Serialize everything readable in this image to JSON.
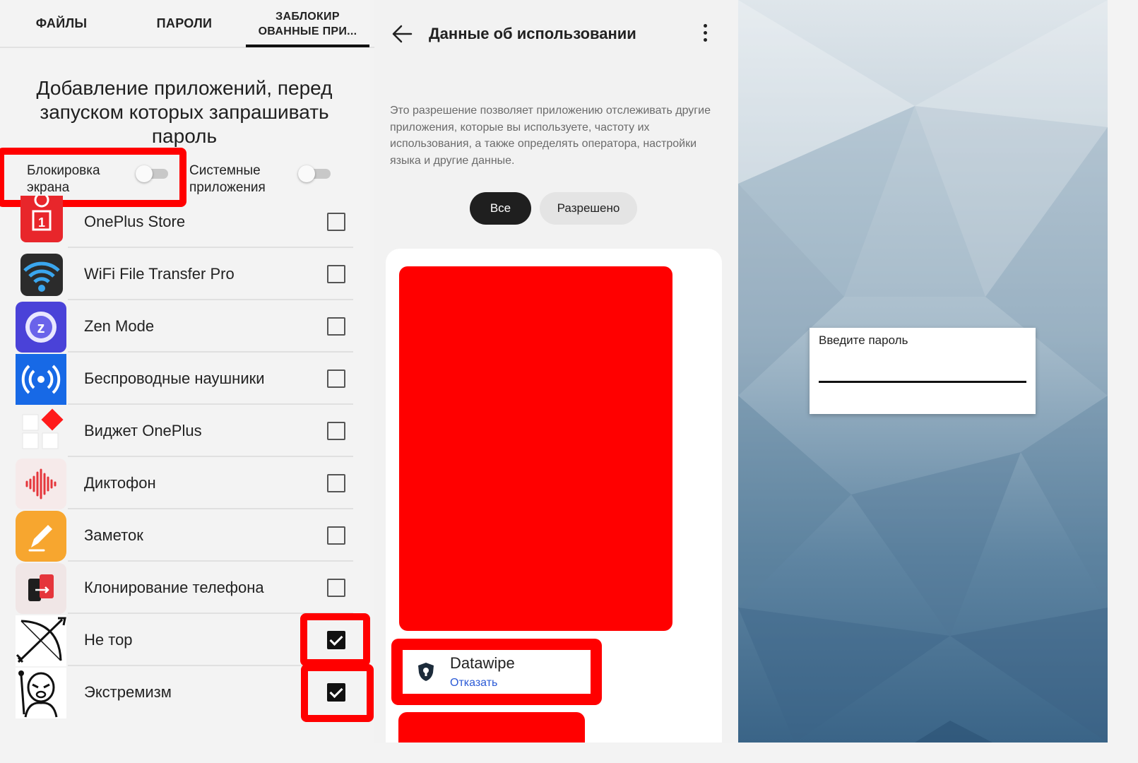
{
  "tabs": [
    {
      "label": "ФАЙЛЫ"
    },
    {
      "label": "ПАРОЛИ"
    },
    {
      "label": "ЗАБЛОКИР ОВАННЫЕ ПРИ..."
    }
  ],
  "lock_screen": {
    "heading": "Добавление приложений, перед запуском которых запрашивать пароль",
    "screen_lock_label": "Блокировка экрана",
    "system_apps_label": "Системные приложения",
    "screen_lock_on": false,
    "system_apps_on": false
  },
  "apps": [
    {
      "name": "OnePlus Store",
      "checked": false,
      "icon": "oneplus-store-icon"
    },
    {
      "name": "WiFi File Transfer Pro",
      "checked": false,
      "icon": "wifi-icon"
    },
    {
      "name": "Zen Mode",
      "checked": false,
      "icon": "zen-mode-icon"
    },
    {
      "name": "Беспроводные наушники",
      "checked": false,
      "icon": "wireless-earbuds-icon"
    },
    {
      "name": "Виджет OnePlus",
      "checked": false,
      "icon": "oneplus-widget-icon"
    },
    {
      "name": "Диктофон",
      "checked": false,
      "icon": "recorder-icon"
    },
    {
      "name": "Заметок",
      "checked": false,
      "icon": "notes-icon"
    },
    {
      "name": "Клонирование телефона",
      "checked": false,
      "icon": "clone-phone-icon"
    },
    {
      "name": "Не тор",
      "checked": true,
      "icon": "bow-arrow-icon"
    },
    {
      "name": "Экстремизм",
      "checked": true,
      "icon": "wizard-icon"
    }
  ],
  "usage": {
    "title": "Данные об использовании",
    "description": "Это разрешение позволяет приложению отслеживать другие приложения, которые вы используете, частоту их использования, а также определять оператора, настройки языка и другие данные.",
    "filters": [
      "Все",
      "Разрешено"
    ],
    "active_filter": "Все",
    "app_name": "Datawipe",
    "app_action": "Отказать"
  },
  "password_dialog": {
    "label": "Введите пароль",
    "value": ""
  },
  "colors": {
    "highlight_red": "#ff0000",
    "link_blue": "#2a5ad6",
    "active_chip": "#1f1f1f"
  }
}
